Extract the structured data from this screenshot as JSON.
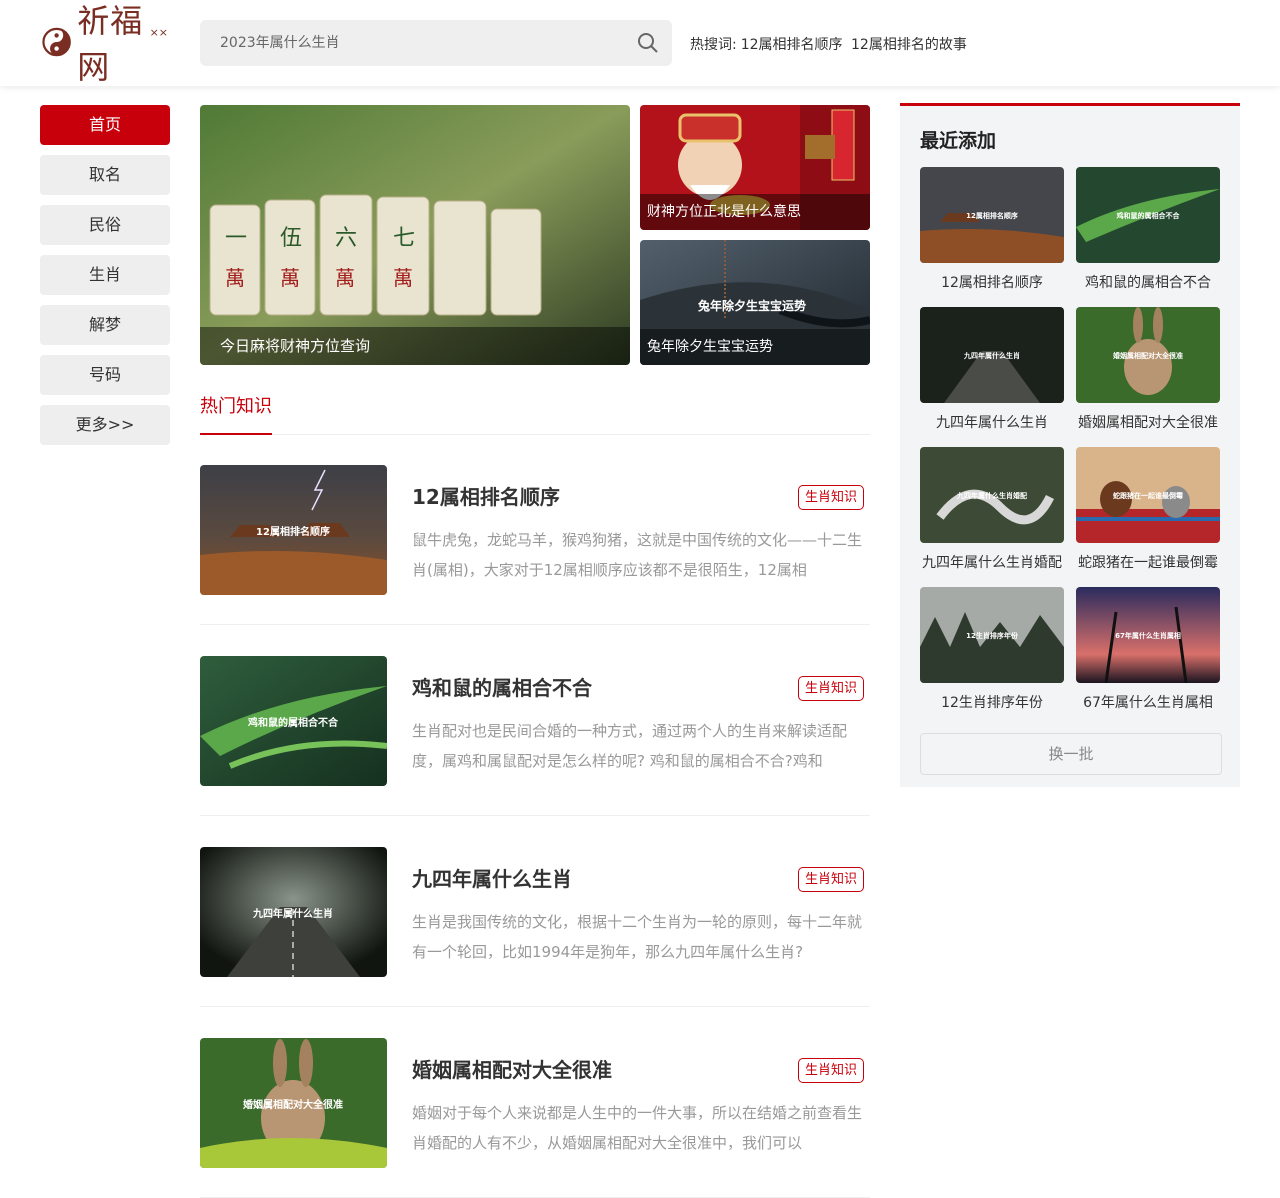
{
  "header": {
    "logo_text": "祈福网",
    "logo_sup": "××",
    "search_placeholder": "2023年属什么生肖",
    "hot_label": "热搜词:",
    "hot_words": [
      "12属相排名顺序",
      "12属相排名的故事"
    ]
  },
  "nav": {
    "items": [
      "首页",
      "取名",
      "民俗",
      "生肖",
      "解梦",
      "号码",
      "更多>>"
    ],
    "active": "首页"
  },
  "hero": {
    "main": "今日麻将财神方位查询",
    "top_right": "财神方位正北是什么意思",
    "bottom_right": "兔年除夕生宝宝运势",
    "bottom_right_overlay": "兔年除夕生宝宝运势"
  },
  "section": {
    "title": "热门知识"
  },
  "articles": [
    {
      "title": "12属相排名顺序",
      "tag": "生肖知识",
      "thumb_text": "12属相排名顺序",
      "desc": "鼠牛虎兔，龙蛇马羊，猴鸡狗猪，这就是中国传统的文化——十二生肖(属相)，大家对于12属相顺序应该都不是很陌生，12属相"
    },
    {
      "title": "鸡和鼠的属相合不合",
      "tag": "生肖知识",
      "thumb_text": "鸡和鼠的属相合不合",
      "desc": "生肖配对也是民间合婚的一种方式，通过两个人的生肖来解读适配度，属鸡和属鼠配对是怎么样的呢? 鸡和鼠的属相合不合?鸡和"
    },
    {
      "title": "九四年属什么生肖",
      "tag": "生肖知识",
      "thumb_text": "九四年属什么生肖",
      "desc": "生肖是我国传统的文化，根据十二个生肖为一轮的原则，每十二年就有一个轮回，比如1994年是狗年，那么九四年属什么生肖?"
    },
    {
      "title": "婚姻属相配对大全很准",
      "tag": "生肖知识",
      "thumb_text": "婚姻属相配对大全很准",
      "desc": "婚姻对于每个人来说都是人生中的一件大事，所以在结婚之前查看生肖婚配的人有不少，从婚姻属相配对大全很准中，我们可以"
    }
  ],
  "recent": {
    "title": "最近添加",
    "items": [
      {
        "label": "12属相排名顺序",
        "thumb_text": "12属相排名顺序"
      },
      {
        "label": "鸡和鼠的属相合不合",
        "thumb_text": "鸡和鼠的属相合不合"
      },
      {
        "label": "九四年属什么生肖",
        "thumb_text": "九四年属什么生肖"
      },
      {
        "label": "婚姻属相配对大全很准",
        "thumb_text": "婚姻属相配对大全很准"
      },
      {
        "label": "九四年属什么生肖婚配",
        "thumb_text": "九四年属什么生肖婚配"
      },
      {
        "label": "蛇跟猪在一起谁最倒霉",
        "thumb_text": "蛇跟猪在一起谁最倒霉"
      },
      {
        "label": "12生肖排序年份",
        "thumb_text": "12生肖排序年份"
      },
      {
        "label": "67年属什么生肖属相",
        "thumb_text": "67年属什么生肖属相"
      }
    ],
    "refresh_label": "换一批"
  },
  "colors": {
    "accent": "#c7000b",
    "logo": "#7a2e23"
  }
}
